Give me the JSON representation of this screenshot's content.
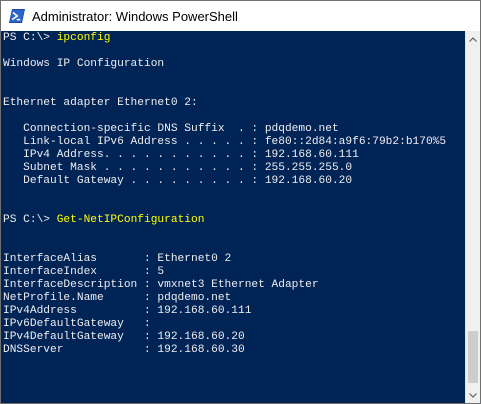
{
  "window": {
    "title": "Administrator: Windows PowerShell",
    "icon": "powershell-icon"
  },
  "console": {
    "colors": {
      "background": "#012456",
      "foreground": "#eeedf0",
      "command": "#ffff00"
    },
    "lines": [
      {
        "prompt": "PS C:\\> ",
        "command": "ipconfig"
      },
      {
        "text": ""
      },
      {
        "text": "Windows IP Configuration"
      },
      {
        "text": ""
      },
      {
        "text": ""
      },
      {
        "text": "Ethernet adapter Ethernet0 2:"
      },
      {
        "text": ""
      },
      {
        "text": "   Connection-specific DNS Suffix  . : pdqdemo.net"
      },
      {
        "text": "   Link-local IPv6 Address . . . . . : fe80::2d84:a9f6:79b2:b170%5"
      },
      {
        "text": "   IPv4 Address. . . . . . . . . . . : 192.168.60.111"
      },
      {
        "text": "   Subnet Mask . . . . . . . . . . . : 255.255.255.0"
      },
      {
        "text": "   Default Gateway . . . . . . . . . : 192.168.60.20"
      },
      {
        "text": ""
      },
      {
        "text": ""
      },
      {
        "prompt": "PS C:\\> ",
        "command": "Get-NetIPConfiguration"
      },
      {
        "text": ""
      },
      {
        "text": ""
      },
      {
        "text": "InterfaceAlias       : Ethernet0 2"
      },
      {
        "text": "InterfaceIndex       : 5"
      },
      {
        "text": "InterfaceDescription : vmxnet3 Ethernet Adapter"
      },
      {
        "text": "NetProfile.Name      : pdqdemo.net"
      },
      {
        "text": "IPv4Address          : 192.168.60.111"
      },
      {
        "text": "IPv6DefaultGateway   :"
      },
      {
        "text": "IPv4DefaultGateway   : 192.168.60.20"
      },
      {
        "text": "DNSServer            : 192.168.60.30"
      }
    ]
  },
  "scrollbar": {
    "up_icon": "scroll-up-arrow-icon",
    "down_icon": "scroll-down-arrow-icon"
  }
}
